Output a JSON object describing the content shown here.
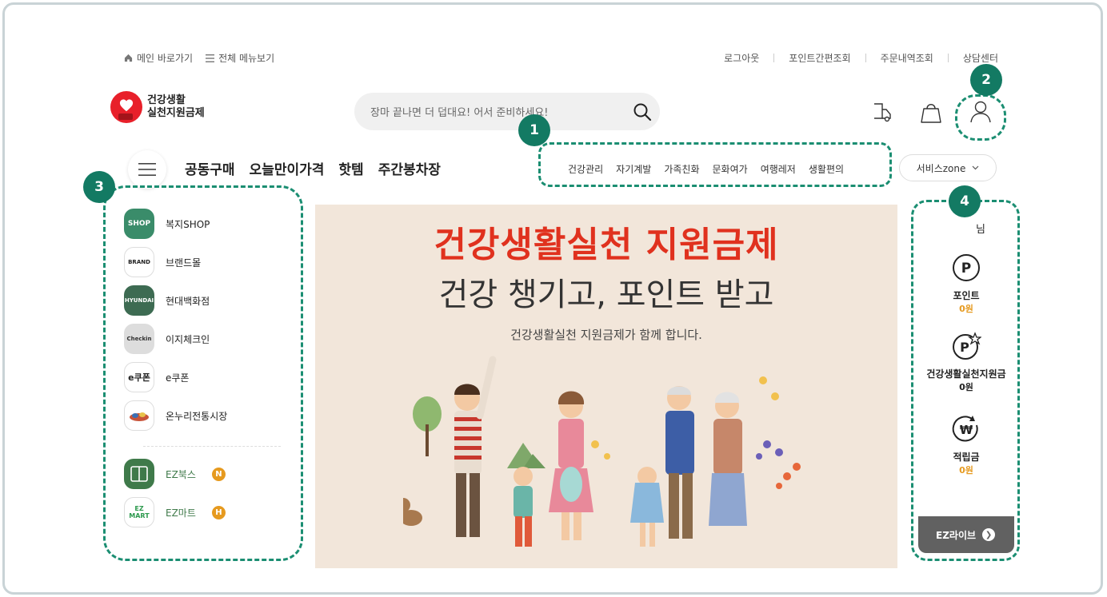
{
  "util": {
    "home_label": "메인 바로가기",
    "allmenu_label": "전체 메뉴보기",
    "logout": "로그아웃",
    "point_check": "포인트간편조회",
    "order_check": "주문내역조회",
    "support": "상담센터"
  },
  "logo": {
    "line1": "건강생활",
    "line2": "실천지원금제"
  },
  "search": {
    "placeholder": "장마 끝나면 더 덥대요! 어서 준비하세요!"
  },
  "nav": {
    "main": [
      "공동구매",
      "오늘만이가격",
      "핫템",
      "주간봉차장"
    ],
    "sub": [
      "건강관리",
      "자기계발",
      "가족친화",
      "문화여가",
      "여행레저",
      "생활편의"
    ],
    "service_zone": "서비스zone"
  },
  "badges": [
    "1",
    "2",
    "3",
    "4"
  ],
  "left_panel": {
    "items": [
      {
        "label": "복지SHOP",
        "icon_text": "SHOP",
        "color": "#3a8c6a"
      },
      {
        "label": "브랜드몰",
        "icon_text": "BRAND",
        "color": "#ffffff"
      },
      {
        "label": "현대백화점",
        "icon_text": "HYUNDAI",
        "color": "#3d6b52"
      },
      {
        "label": "이지체크인",
        "icon_text": "Checkin",
        "color": "#dddddd"
      },
      {
        "label": "e쿠폰",
        "icon_text": "e쿠폰",
        "color": "#ffffff"
      },
      {
        "label": "온누리전통시장",
        "icon_text": "",
        "color": "#ffffff"
      }
    ],
    "bottom_items": [
      {
        "label": "EZ북스",
        "badge": "N",
        "icon_text": "",
        "color": "#3f7a4a"
      },
      {
        "label": "EZ마트",
        "badge": "H",
        "icon_text": "EZ MART",
        "color": "#ffffff"
      }
    ]
  },
  "banner": {
    "title": "건강생활실천 지원금제",
    "subtitle": "건강 챙기고, 포인트 받고",
    "desc": "건강생활실천 지원금제가 함께 합니다."
  },
  "right_panel": {
    "name_suffix": "님",
    "items": [
      {
        "label": "포인트",
        "value": "0원",
        "value_color": "#e69a1f",
        "icon": "point-icon"
      },
      {
        "label": "건강생활실천지원금",
        "value": "0원",
        "value_color": "#222222",
        "icon": "point-star-icon"
      },
      {
        "label": "적립금",
        "value": "0원",
        "value_color": "#e69a1f",
        "icon": "won-refresh-icon"
      }
    ],
    "ezlive": "EZ라이브"
  },
  "colors": {
    "accent_green": "#1b8e72",
    "badge_green": "#137a63",
    "brand_red": "#e8202a",
    "point_orange": "#e69a1f"
  }
}
